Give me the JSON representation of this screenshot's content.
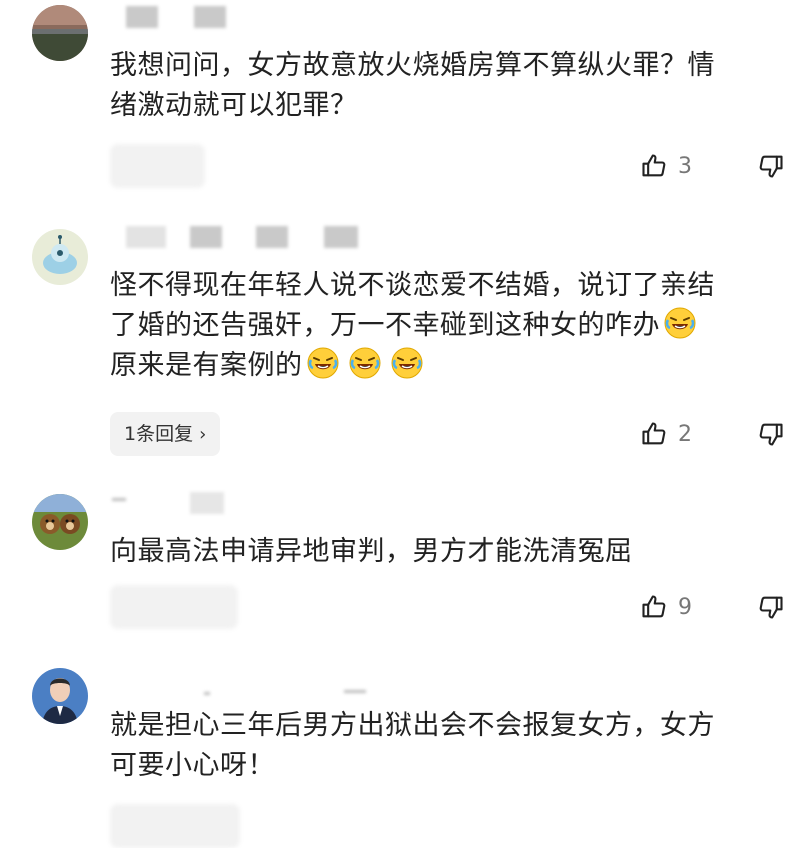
{
  "comments": [
    {
      "text_lines": [
        "我想问问，女方故意放火烧婚房算不算纵火罪？情",
        "绪激动就可以犯罪？"
      ],
      "likes": "3",
      "reply_label": ""
    },
    {
      "text_lines": [
        "怪不得现在年轻人说不谈恋爱不结婚，说订了亲结",
        "了婚的还告强奸，万一不幸碰到这种女的咋办",
        "原来是有案例的"
      ],
      "likes": "2",
      "reply_label": "1条回复"
    },
    {
      "text_lines": [
        "向最高法申请异地审判，男方才能洗清冤屈"
      ],
      "likes": "9",
      "reply_label": ""
    },
    {
      "text_lines": [
        "就是担心三年后男方出狱出会不会报复女方，女方",
        "可要小心呀！"
      ],
      "likes": "",
      "reply_label": ""
    }
  ],
  "icons": {
    "like": "thumbs-up-outline-icon",
    "dislike": "thumbs-down-outline-icon",
    "emoji": "rofl-emoji-icon"
  },
  "colors": {
    "text": "#222222",
    "meta": "#777777",
    "button_bg": "#f2f2f2"
  }
}
